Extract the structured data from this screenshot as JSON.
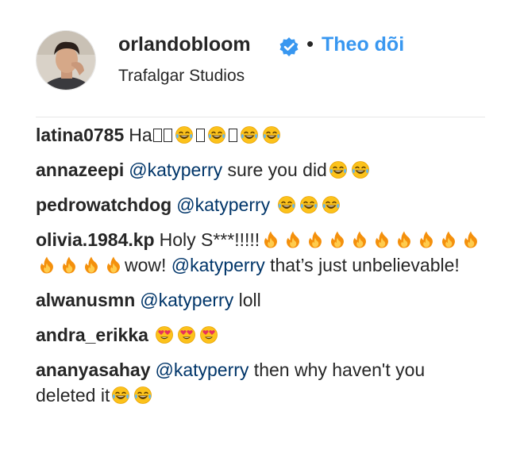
{
  "header": {
    "username": "orlandobloom",
    "separator": "•",
    "follow_label": "Theo dõi",
    "location": "Trafalgar Studios",
    "verified": true,
    "verified_color": "#3897f0"
  },
  "comments": [
    {
      "user": "latina0785",
      "parts": [
        {
          "t": "text",
          "v": "Ha"
        },
        {
          "t": "tofu"
        },
        {
          "t": "tofu"
        },
        {
          "t": "emoji",
          "icon": "laughing-tears-icon"
        },
        {
          "t": "tofu"
        },
        {
          "t": "emoji",
          "icon": "laughing-tears-icon"
        },
        {
          "t": "tofu"
        },
        {
          "t": "emoji",
          "icon": "laughing-tears-icon"
        },
        {
          "t": "emoji",
          "icon": "laughing-tears-icon"
        }
      ]
    },
    {
      "user": "annazeepi",
      "parts": [
        {
          "t": "mention",
          "v": "@katyperry"
        },
        {
          "t": "text",
          "v": " sure you did"
        },
        {
          "t": "emoji",
          "icon": "laughing-tears-icon"
        },
        {
          "t": "emoji",
          "icon": "laughing-tears-icon"
        }
      ]
    },
    {
      "user": "pedrowatchdog",
      "parts": [
        {
          "t": "mention",
          "v": "@katyperry"
        },
        {
          "t": "text",
          "v": " "
        },
        {
          "t": "emoji",
          "icon": "laughing-tears-icon"
        },
        {
          "t": "emoji",
          "icon": "laughing-tears-icon"
        },
        {
          "t": "emoji",
          "icon": "laughing-tears-icon"
        }
      ]
    },
    {
      "user": "olivia.1984.kp",
      "parts": [
        {
          "t": "text",
          "v": "Holy S***!!!!!"
        },
        {
          "t": "emoji",
          "icon": "fire-icon"
        },
        {
          "t": "emoji",
          "icon": "fire-icon"
        },
        {
          "t": "emoji",
          "icon": "fire-icon"
        },
        {
          "t": "emoji",
          "icon": "fire-icon"
        },
        {
          "t": "emoji",
          "icon": "fire-icon"
        },
        {
          "t": "emoji",
          "icon": "fire-icon"
        },
        {
          "t": "emoji",
          "icon": "fire-icon"
        },
        {
          "t": "emoji",
          "icon": "fire-icon"
        },
        {
          "t": "emoji",
          "icon": "fire-icon"
        },
        {
          "t": "emoji",
          "icon": "fire-icon"
        },
        {
          "t": "emoji",
          "icon": "fire-icon"
        },
        {
          "t": "emoji",
          "icon": "fire-icon"
        },
        {
          "t": "emoji",
          "icon": "fire-icon"
        },
        {
          "t": "emoji",
          "icon": "fire-icon"
        },
        {
          "t": "text",
          "v": "wow! "
        },
        {
          "t": "mention",
          "v": "@katyperry"
        },
        {
          "t": "text",
          "v": " that’s just unbelievable!"
        }
      ]
    },
    {
      "user": "alwanusmn",
      "parts": [
        {
          "t": "mention",
          "v": "@katyperry"
        },
        {
          "t": "text",
          "v": " loll"
        }
      ]
    },
    {
      "user": "andra_erikka",
      "parts": [
        {
          "t": "emoji",
          "icon": "heart-eyes-icon"
        },
        {
          "t": "emoji",
          "icon": "heart-eyes-icon"
        },
        {
          "t": "emoji",
          "icon": "heart-eyes-icon"
        }
      ]
    },
    {
      "user": "ananyasahay",
      "parts": [
        {
          "t": "mention",
          "v": "@katyperry"
        },
        {
          "t": "text",
          "v": " then why haven't you deleted it"
        },
        {
          "t": "emoji",
          "icon": "laughing-tears-icon"
        },
        {
          "t": "emoji",
          "icon": "laughing-tears-icon"
        }
      ]
    }
  ]
}
